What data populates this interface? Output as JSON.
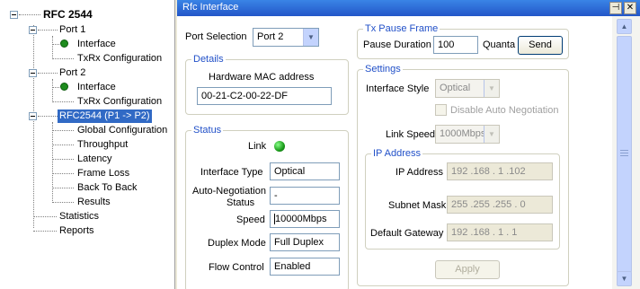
{
  "tree": {
    "root": "RFC 2544",
    "port1": {
      "label": "Port 1",
      "interface": "Interface",
      "txrx": "TxRx Configuration"
    },
    "port2": {
      "label": "Port 2",
      "interface": "Interface",
      "txrx": "TxRx Configuration"
    },
    "rfc": {
      "label": "RFC2544 (P1 -> P2)",
      "items": [
        "Global Configuration",
        "Throughput",
        "Latency",
        "Frame Loss",
        "Back To Back",
        "Results"
      ]
    },
    "statistics": "Statistics",
    "reports": "Reports"
  },
  "window": {
    "title": "Rfc Interface",
    "pin_glyph": "📌",
    "close_glyph": "✕"
  },
  "port_selection": {
    "label": "Port Selection",
    "value": "Port 2"
  },
  "details": {
    "legend": "Details",
    "mac_label": "Hardware MAC address",
    "mac_value": "00-21-C2-00-22-DF"
  },
  "status": {
    "legend": "Status",
    "link_label": "Link",
    "interface_type_label": "Interface Type",
    "interface_type_value": "Optical",
    "autoneg_label_1": "Auto-Negotiation",
    "autoneg_label_2": "Status",
    "autoneg_value": "-",
    "speed_label": "Speed",
    "speed_value": "10000Mbps",
    "duplex_label": "Duplex Mode",
    "duplex_value": "Full Duplex",
    "flow_label": "Flow Control",
    "flow_value": "Enabled"
  },
  "tx_pause": {
    "legend": "Tx Pause Frame",
    "duration_label": "Pause Duration",
    "duration_value": "100",
    "unit": "Quanta",
    "send": "Send"
  },
  "settings": {
    "legend": "Settings",
    "style_label": "Interface Style",
    "style_value": "Optical",
    "disable_autoneg": "Disable Auto Negotiation",
    "link_speed_label": "Link Speed",
    "link_speed_value": "1000Mbps",
    "ip": {
      "legend": "IP Address",
      "address_label": "IP Address",
      "address_value": "192 .168 .  1  .102",
      "mask_label": "Subnet Mask",
      "mask_value": "255 .255 .255 .  0",
      "gateway_label": "Default Gateway",
      "gateway_value": "192 .168 .  1  .  1"
    },
    "apply": "Apply"
  },
  "colors": {
    "title_bar": "#2a62d4",
    "link_led": "#1a9a1a",
    "legend_text": "#2150c8",
    "selection": "#316ac5"
  }
}
